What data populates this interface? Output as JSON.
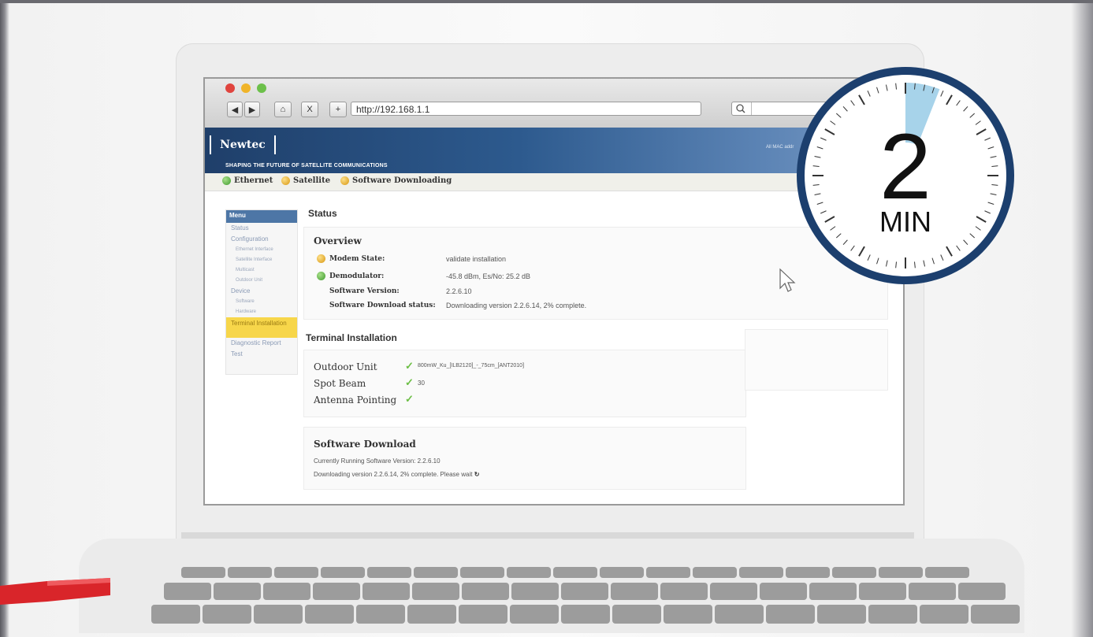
{
  "browser": {
    "back": "◀",
    "forward": "▶",
    "home": "⌂",
    "stop": "X",
    "add": "+",
    "url": "http://192.168.1.1",
    "search_icon": "magnifier-icon"
  },
  "header": {
    "logo": "Newtec",
    "tagline": "SHAPING THE FUTURE OF SATELLITE COMMUNICATIONS",
    "right_text": "All MAC addr"
  },
  "indicators": [
    {
      "label": "Ethernet",
      "color": "#5cb947"
    },
    {
      "label": "Satellite",
      "color": "#f0b429"
    },
    {
      "label": "Software Downloading",
      "color": "#f0b429"
    }
  ],
  "menu": {
    "title": "Menu",
    "items": [
      {
        "label": "Status",
        "level": 1
      },
      {
        "label": "Configuration",
        "level": 1
      },
      {
        "label": "Ethernet Interface",
        "level": 2
      },
      {
        "label": "Satellite Interface",
        "level": 2
      },
      {
        "label": "Multicast",
        "level": 2
      },
      {
        "label": "Outdoor Unit",
        "level": 2
      },
      {
        "label": "Device",
        "level": 1
      },
      {
        "label": "Software",
        "level": 2
      },
      {
        "label": "Hardware",
        "level": 2
      },
      {
        "label": "Terminal Installation",
        "level": 1,
        "selected": true
      },
      {
        "label": "Diagnostic Report",
        "level": 1
      },
      {
        "label": "Test",
        "level": 1
      }
    ]
  },
  "status": {
    "title": "Status",
    "overview": {
      "title": "Overview",
      "modem_state_label": "Modem State:",
      "modem_state_value": "validate installation",
      "demodulator_label": "Demodulator:",
      "demodulator_value": "-45.8 dBm, Es/No: 25.2 dB",
      "software_version_label": "Software Version:",
      "software_version_value": "2.2.6.10",
      "download_status_label": "Software Download status:",
      "download_status_value": "Downloading version 2.2.6.14, 2% complete."
    }
  },
  "terminal": {
    "title": "Terminal Installation",
    "outdoor_unit_label": "Outdoor Unit",
    "outdoor_unit_value": "800mW_Ku_[ILB2120]_-_75cm_[ANT2010]",
    "spot_beam_label": "Spot Beam",
    "spot_beam_value": "30",
    "antenna_label": "Antenna Pointing",
    "check": "✓"
  },
  "download": {
    "title": "Software Download",
    "running": "Currently Running Software Version: 2.2.6.10",
    "progress": "Downloading version 2.2.6.14, 2% complete. Please wait"
  },
  "timer": {
    "number": "2",
    "unit": "MIN",
    "elapsed_fraction": 0.06,
    "ring_color": "#1c3f6e",
    "highlight_color": "#a7d3ea"
  },
  "colors": {
    "cable": "#d9252a",
    "banner": "#2d5a8e"
  }
}
